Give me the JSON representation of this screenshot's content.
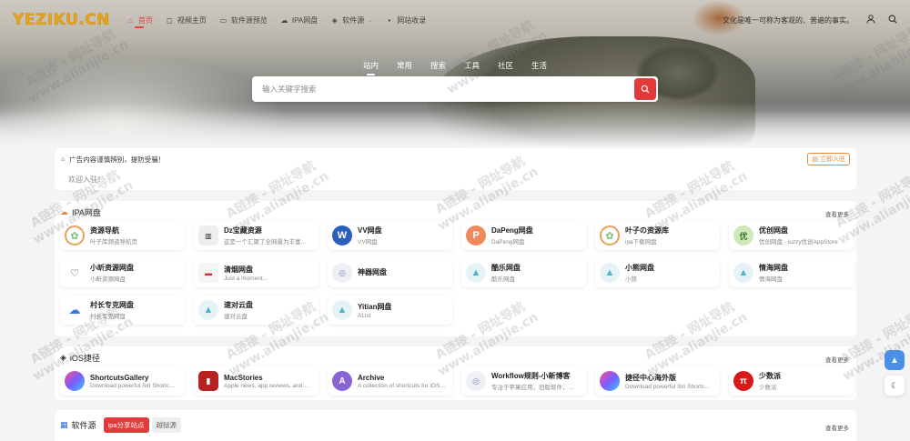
{
  "header": {
    "logo": "YEZIKU.CN",
    "nav": [
      {
        "label": "首页",
        "icon": "home-icon"
      },
      {
        "label": "视频主页",
        "icon": "bookmark-icon"
      },
      {
        "label": "软件源预览",
        "icon": "folder-icon"
      },
      {
        "label": "IPA网盘",
        "icon": "cloud-icon"
      },
      {
        "label": "软件源",
        "icon": "layers-icon"
      },
      {
        "label": "网站收录",
        "icon": "message-icon"
      }
    ],
    "quote": "文化是唯一可称为客观的、普遍的事实。"
  },
  "search": {
    "tabs": [
      "站内",
      "常用",
      "搜索",
      "工具",
      "社区",
      "生活"
    ],
    "placeholder": "输入关键字搜索"
  },
  "notice": {
    "text": "广告内容谨慎辨别，提防受骗！",
    "join": "立即入驻",
    "welcome": "欢迎入驻！"
  },
  "ipa": {
    "title": "IPA网盘",
    "more": "查看更多",
    "items": [
      {
        "name": "资源导航",
        "desc": "叶子库频道导航页"
      },
      {
        "name": "Dz宝藏资源",
        "desc": "这是一个汇聚了全网最为丰富…"
      },
      {
        "name": "VV网盘",
        "desc": "VV网盘"
      },
      {
        "name": "DaPeng网盘",
        "desc": "DaPeng网盘"
      },
      {
        "name": "叶子の资源库",
        "desc": "ipa下载网盘"
      },
      {
        "name": "优创网盘",
        "desc": "优创网盘 - iuzzy优创AppStore"
      },
      {
        "name": "小昕资源网盘",
        "desc": "小昕资源网盘"
      },
      {
        "name": "清烟网盘",
        "desc": "Just a moment..."
      },
      {
        "name": "神器网盘",
        "desc": ""
      },
      {
        "name": "酷乐网盘",
        "desc": "酷乐网盘"
      },
      {
        "name": "小熊网盘",
        "desc": "小熊"
      },
      {
        "name": "情海网盘",
        "desc": "情海网盘"
      },
      {
        "name": "村长专克网盘",
        "desc": "村长专克网盘"
      },
      {
        "name": "速对云盘",
        "desc": "速对云盘"
      },
      {
        "name": "Yitian网盘",
        "desc": "AList"
      }
    ]
  },
  "ios": {
    "title": "iOS捷径",
    "more": "查看更多",
    "items": [
      {
        "name": "ShortcutsGallery",
        "desc": "Download powerful Siri Shortc…"
      },
      {
        "name": "MacStories",
        "desc": "Apple news, app reviews, and …"
      },
      {
        "name": "Archive",
        "desc": "A collection of shortcuts for iOS…"
      },
      {
        "name": "Workflow规则-小新博客",
        "desc": "专注于苹果应用，旧版软件，…"
      },
      {
        "name": "捷径中心海外版",
        "desc": "Download powerful Siri Shortc…"
      },
      {
        "name": "少数派",
        "desc": "少数派"
      }
    ]
  },
  "software": {
    "title": "软件源",
    "tags": [
      "ipa分享站点",
      "越狱源"
    ],
    "more": "查看更多"
  },
  "colors": {
    "accent": "#e23a3a",
    "logo": "#e8a317"
  },
  "watermark": {
    "line1": "A链接 - 网址导航",
    "line2": "www.alianjie.cn"
  }
}
